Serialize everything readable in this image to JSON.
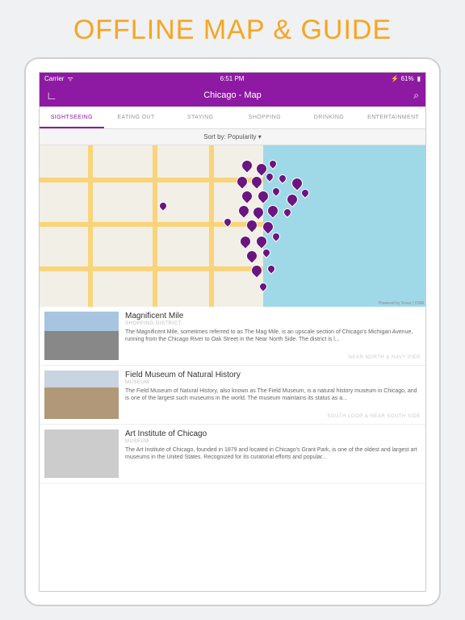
{
  "banner": "OFFLINE MAP & GUIDE",
  "status": {
    "carrier": "Carrier",
    "time": "6:51 PM",
    "battery": "61%"
  },
  "nav": {
    "title": "Chicago - Map"
  },
  "tabs": [
    "SIGHTSEEING",
    "EATING OUT",
    "STAYING",
    "SHOPPING",
    "DRINKING",
    "ENTERTAINMENT"
  ],
  "sort": {
    "label": "Sort by: Popularity ▾"
  },
  "map": {
    "attrib": "Powered by Scout | OSM"
  },
  "items": [
    {
      "name": "Magnificent Mile",
      "cat": "SHOPPING DISTRICT",
      "desc": "The Magnificent Mile, sometimes referred to as The Mag Mile, is an upscale section of Chicago's Michigan Avenue, running from the Chicago River to Oak Street in the Near North Side. The district is l...",
      "area": "NEAR NORTH & NAVY PIER",
      "thumb": "t1"
    },
    {
      "name": "Field Museum of Natural History",
      "cat": "MUSEUM",
      "desc": "The Field Museum of Natural History, also known as The Field Museum, is a natural history museum in Chicago, and is one of the largest such museums in the world. The museum maintains its status as a...",
      "area": "SOUTH LOOP & NEAR SOUTH SIDE",
      "thumb": "t2"
    },
    {
      "name": "Art Institute of Chicago",
      "cat": "MUSEUM",
      "desc": "The Art Institute of Chicago, founded in 1879 and located in Chicago's Grant Park, is one of the oldest and largest art museums in the United States. Recognized for its curatorial efforts and popular...",
      "area": "",
      "thumb": "t3"
    }
  ]
}
